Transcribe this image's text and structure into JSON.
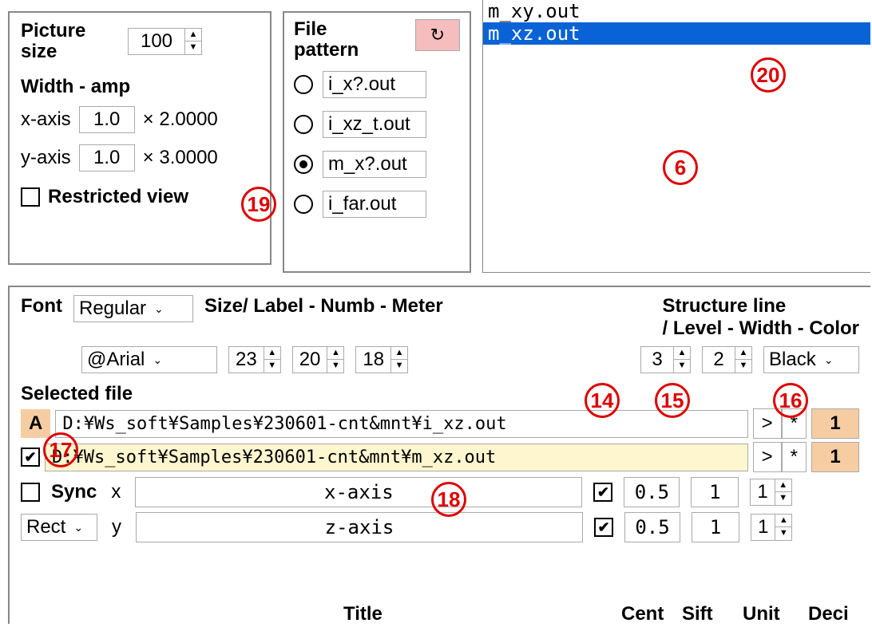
{
  "picture_size": {
    "title": "Picture size",
    "value": "100",
    "width_amp_label": "Width - amp",
    "x_label": "x-axis",
    "x_value": "1.0",
    "x_mult": "× 2.0000",
    "y_label": "y-axis",
    "y_value": "1.0",
    "y_mult": "× 3.0000",
    "restricted_label": "Restricted view"
  },
  "file_pattern": {
    "title": "File pattern",
    "refresh": "↻",
    "options": [
      "i_x?.out",
      "i_xz_t.out",
      "m_x?.out",
      "i_far.out"
    ],
    "selected_index": 2
  },
  "file_list": {
    "items": [
      "m_xy.out",
      "m_xz.out"
    ],
    "selected_index": 1
  },
  "font_section": {
    "font_label": "Font",
    "style": "Regular",
    "family": "@Arial",
    "size_label": "Size/ Label - Numb - Meter",
    "label_size": "23",
    "numb_size": "20",
    "meter_size": "18",
    "struct_label1": "Structure line",
    "struct_label2": "/ Level - Width - Color",
    "level": "3",
    "width": "2",
    "color": "Black"
  },
  "selected_file": {
    "title": "Selected file",
    "row_a_mark": "A",
    "row_a_path": "D:¥Ws_soft¥Samples¥230601-cnt&mnt¥i_xz.out",
    "row_a_num": "1",
    "row_b_path": "D:¥Ws_soft¥Samples¥230601-cnt&mnt¥m_xz.out",
    "row_b_num": "1",
    "gt": ">",
    "star": "*",
    "sync_label": "Sync",
    "shape": "Rect",
    "x_letter": "x",
    "y_letter": "y",
    "x_title": "x-axis",
    "y_title": "z-axis",
    "x_cent": "0.5",
    "x_unit": "1",
    "x_deci": "1",
    "y_cent": "0.5",
    "y_unit": "1",
    "y_deci": "1"
  },
  "footers": {
    "title": "Title",
    "cent": "Cent",
    "sift": "Sift",
    "unit": "Unit",
    "deci": "Deci"
  },
  "annotations": {
    "a6": "6",
    "a14": "14",
    "a15": "15",
    "a16": "16",
    "a17": "17",
    "a18": "18",
    "a19": "19",
    "a20": "20"
  }
}
